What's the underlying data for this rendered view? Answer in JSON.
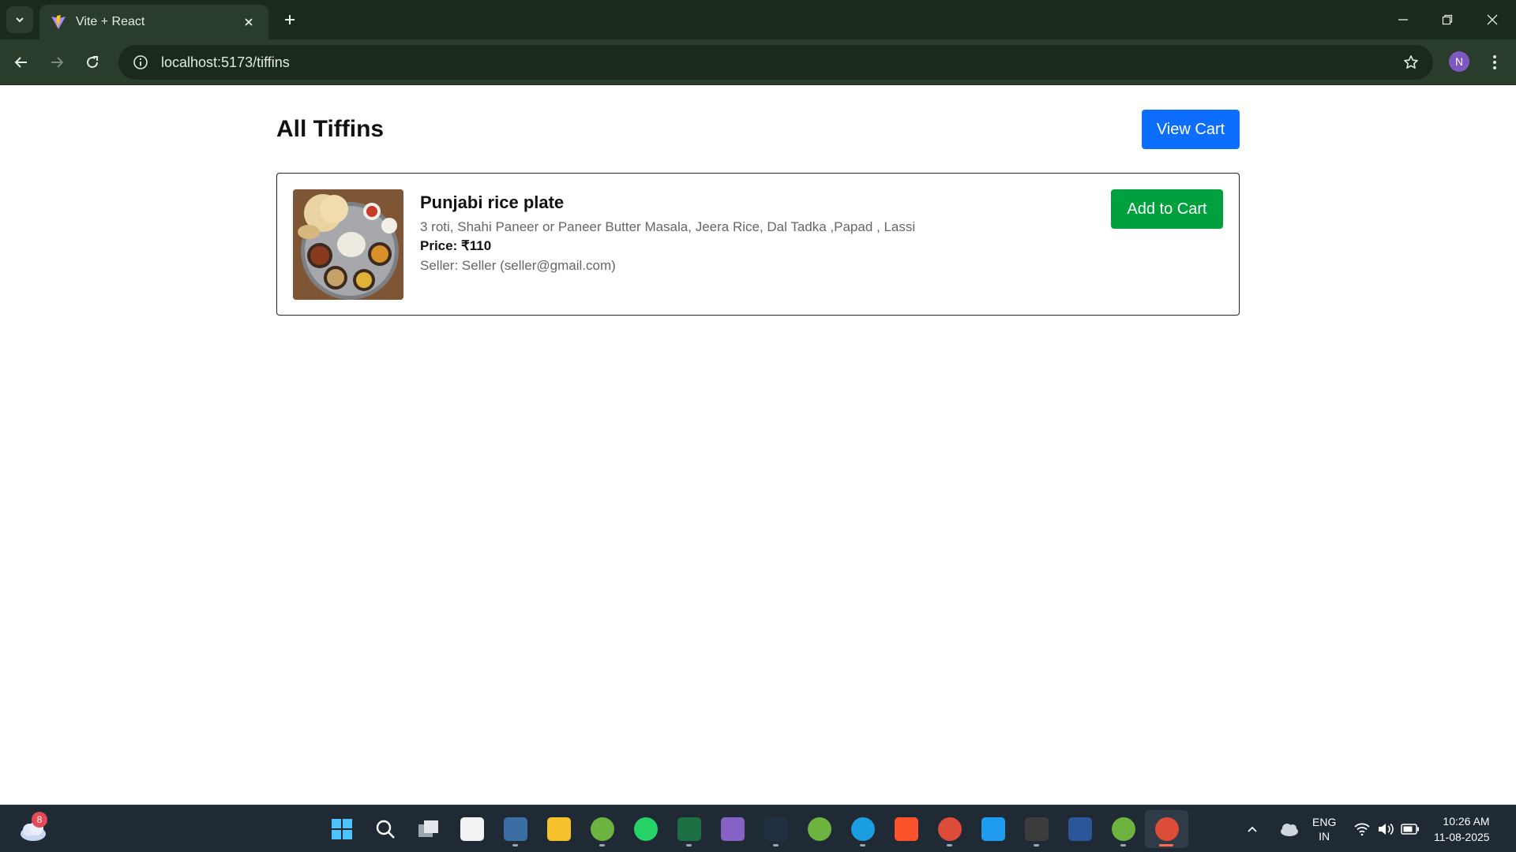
{
  "browser": {
    "tab_title": "Vite + React",
    "url": "localhost:5173/tiffins",
    "profile_initial": "N"
  },
  "page": {
    "title": "All Tiffins",
    "view_cart_label": "View Cart"
  },
  "tiffins": [
    {
      "name": "Punjabi rice plate",
      "description": "3 roti, Shahi Paneer or Paneer Butter Masala, Jeera Rice, Dal Tadka ,Papad , Lassi",
      "price_label": "Price: ₹110",
      "seller": "Seller: Seller (seller@gmail.com)",
      "add_label": "Add to Cart"
    }
  ],
  "taskbar": {
    "weather_badge": "8",
    "apps": [
      {
        "name": "start-icon",
        "color": "#3aa0ff"
      },
      {
        "name": "search-icon",
        "color": "#ffffff"
      },
      {
        "name": "task-view-icon",
        "color": "#c8d0d8"
      },
      {
        "name": "store-icon",
        "color": "#f3f3f3"
      },
      {
        "name": "mysql-workbench-icon",
        "color": "#3a6ea5"
      },
      {
        "name": "file-explorer-icon",
        "color": "#f7c12d"
      },
      {
        "name": "spring-tools-icon",
        "color": "#6db33f"
      },
      {
        "name": "whatsapp-icon",
        "color": "#25d366"
      },
      {
        "name": "excel-icon",
        "color": "#1d7044"
      },
      {
        "name": "visual-studio-icon",
        "color": "#8661c5"
      },
      {
        "name": "mysql-shell-icon",
        "color": "#203040"
      },
      {
        "name": "spring-boot-icon",
        "color": "#6db33f"
      },
      {
        "name": "edge-icon",
        "color": "#1b9de2"
      },
      {
        "name": "brave-icon",
        "color": "#fb542b"
      },
      {
        "name": "chrome-icon",
        "color": "#dd4b39"
      },
      {
        "name": "vscode-icon",
        "color": "#1f9cf0"
      },
      {
        "name": "terminal-icon",
        "color": "#3c3c3c"
      },
      {
        "name": "word-icon",
        "color": "#2b579a"
      },
      {
        "name": "spring-icon-2",
        "color": "#6db33f"
      },
      {
        "name": "chrome-profile-icon",
        "color": "#dd4b39"
      }
    ],
    "language_line1": "ENG",
    "language_line2": "IN",
    "time": "10:26 AM",
    "date": "11-08-2025"
  }
}
